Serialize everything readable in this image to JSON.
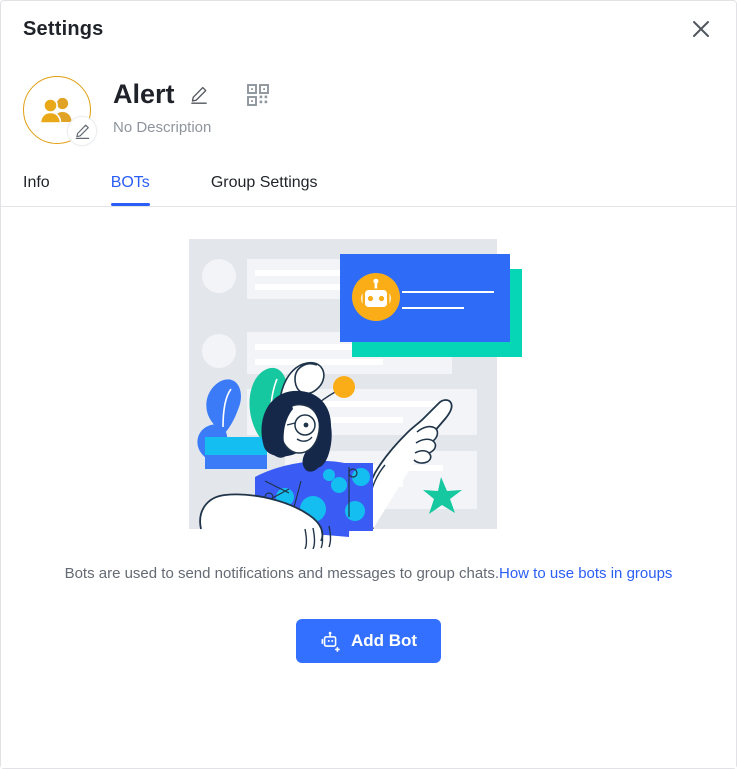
{
  "window": {
    "title": "Settings",
    "close_icon": "close-x-icon"
  },
  "group": {
    "name": "Alert",
    "description": "No Description",
    "avatar_icon": "group-people-icon",
    "avatar_edit_icon": "pencil-edit-icon",
    "name_edit_icon": "pencil-edit-icon",
    "qr_icon": "qr-code-icon"
  },
  "tabs": [
    {
      "label": "Info",
      "active": false
    },
    {
      "label": "BOTs",
      "active": true
    },
    {
      "label": "Group Settings",
      "active": false
    }
  ],
  "empty_state": {
    "illustration_name": "bots-empty-illustration",
    "caption_text": "Bots are used to send notifications and messages to group chats.",
    "caption_link": "How to use bots in groups",
    "add_bot_label": "Add Bot",
    "add_bot_icon": "robot-plus-icon"
  },
  "colors": {
    "accent_blue": "#3370ff",
    "link_blue": "#2b5ef5",
    "avatar_gold": "#e09e12",
    "robot_orange": "#fbad17",
    "teal": "#06d6b6",
    "text_primary": "#1f2329",
    "text_secondary": "#646a73",
    "text_muted": "#8f959e"
  }
}
